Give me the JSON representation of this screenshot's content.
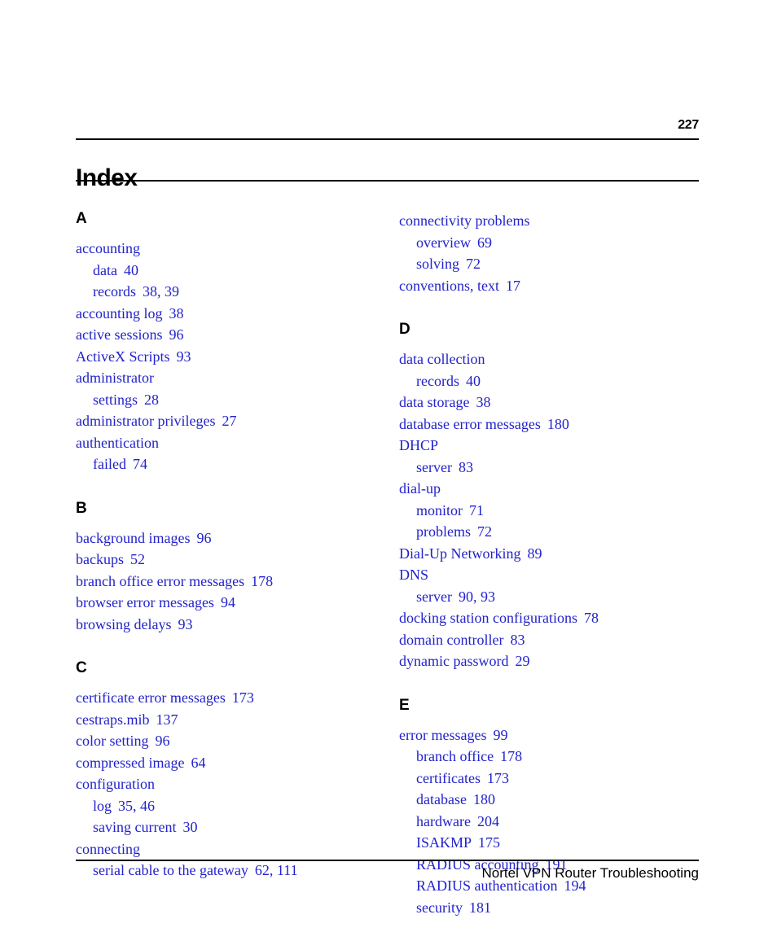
{
  "header": {
    "page_number": "227",
    "title": "Index"
  },
  "footer": {
    "text": "Nortel VPN Router Troubleshooting"
  },
  "colors": {
    "entry_link": "#2222cc",
    "heading": "#000000",
    "rule": "#000000",
    "background": "#ffffff"
  },
  "columns": [
    {
      "name": "left-column",
      "groups": [
        {
          "letter": "A",
          "entries": [
            {
              "level": 1,
              "term": "accounting",
              "pages": ""
            },
            {
              "level": 2,
              "term": "data",
              "pages": "40"
            },
            {
              "level": 2,
              "term": "records",
              "pages": "38, 39"
            },
            {
              "level": 1,
              "term": "accounting log",
              "pages": "38"
            },
            {
              "level": 1,
              "term": "active sessions",
              "pages": "96"
            },
            {
              "level": 1,
              "term": "ActiveX Scripts",
              "pages": "93"
            },
            {
              "level": 1,
              "term": "administrator",
              "pages": ""
            },
            {
              "level": 2,
              "term": "settings",
              "pages": "28"
            },
            {
              "level": 1,
              "term": "administrator privileges",
              "pages": "27"
            },
            {
              "level": 1,
              "term": "authentication",
              "pages": ""
            },
            {
              "level": 2,
              "term": "failed",
              "pages": "74"
            }
          ]
        },
        {
          "letter": "B",
          "entries": [
            {
              "level": 1,
              "term": "background images",
              "pages": "96"
            },
            {
              "level": 1,
              "term": "backups",
              "pages": "52"
            },
            {
              "level": 1,
              "term": "branch office error messages",
              "pages": "178"
            },
            {
              "level": 1,
              "term": "browser error messages",
              "pages": "94"
            },
            {
              "level": 1,
              "term": "browsing delays",
              "pages": "93"
            }
          ]
        },
        {
          "letter": "C",
          "entries": [
            {
              "level": 1,
              "term": "certificate error messages",
              "pages": "173"
            },
            {
              "level": 1,
              "term": "cestraps.mib",
              "pages": "137"
            },
            {
              "level": 1,
              "term": "color setting",
              "pages": "96"
            },
            {
              "level": 1,
              "term": "compressed image",
              "pages": "64"
            },
            {
              "level": 1,
              "term": "configuration",
              "pages": ""
            },
            {
              "level": 2,
              "term": "log",
              "pages": "35, 46"
            },
            {
              "level": 2,
              "term": "saving current",
              "pages": "30"
            },
            {
              "level": 1,
              "term": "connecting",
              "pages": ""
            },
            {
              "level": 2,
              "term": "serial cable to the gateway",
              "pages": "62, 111"
            }
          ]
        }
      ]
    },
    {
      "name": "right-column",
      "groups": [
        {
          "letter": "",
          "entries": [
            {
              "level": 1,
              "term": "connectivity problems",
              "pages": ""
            },
            {
              "level": 2,
              "term": "overview",
              "pages": "69"
            },
            {
              "level": 2,
              "term": "solving",
              "pages": "72"
            },
            {
              "level": 1,
              "term": "conventions, text",
              "pages": "17"
            }
          ]
        },
        {
          "letter": "D",
          "entries": [
            {
              "level": 1,
              "term": "data collection",
              "pages": ""
            },
            {
              "level": 2,
              "term": "records",
              "pages": "40"
            },
            {
              "level": 1,
              "term": "data storage",
              "pages": "38"
            },
            {
              "level": 1,
              "term": "database error messages",
              "pages": "180"
            },
            {
              "level": 1,
              "term": "DHCP",
              "pages": ""
            },
            {
              "level": 2,
              "term": "server",
              "pages": "83"
            },
            {
              "level": 1,
              "term": "dial-up",
              "pages": ""
            },
            {
              "level": 2,
              "term": "monitor",
              "pages": "71"
            },
            {
              "level": 2,
              "term": "problems",
              "pages": "72"
            },
            {
              "level": 1,
              "term": "Dial-Up Networking",
              "pages": "89"
            },
            {
              "level": 1,
              "term": "DNS",
              "pages": ""
            },
            {
              "level": 2,
              "term": "server",
              "pages": "90, 93"
            },
            {
              "level": 1,
              "term": "docking station configurations",
              "pages": "78"
            },
            {
              "level": 1,
              "term": "domain controller",
              "pages": "83"
            },
            {
              "level": 1,
              "term": "dynamic password",
              "pages": "29"
            }
          ]
        },
        {
          "letter": "E",
          "entries": [
            {
              "level": 1,
              "term": "error messages",
              "pages": "99"
            },
            {
              "level": 2,
              "term": "branch office",
              "pages": "178"
            },
            {
              "level": 2,
              "term": "certificates",
              "pages": "173"
            },
            {
              "level": 2,
              "term": "database",
              "pages": "180"
            },
            {
              "level": 2,
              "term": "hardware",
              "pages": "204"
            },
            {
              "level": 2,
              "term": "ISAKMP",
              "pages": "175"
            },
            {
              "level": 2,
              "term": "RADIUS accounting",
              "pages": "191"
            },
            {
              "level": 2,
              "term": "RADIUS authentication",
              "pages": "194"
            },
            {
              "level": 2,
              "term": "security",
              "pages": "181"
            }
          ]
        }
      ]
    }
  ]
}
